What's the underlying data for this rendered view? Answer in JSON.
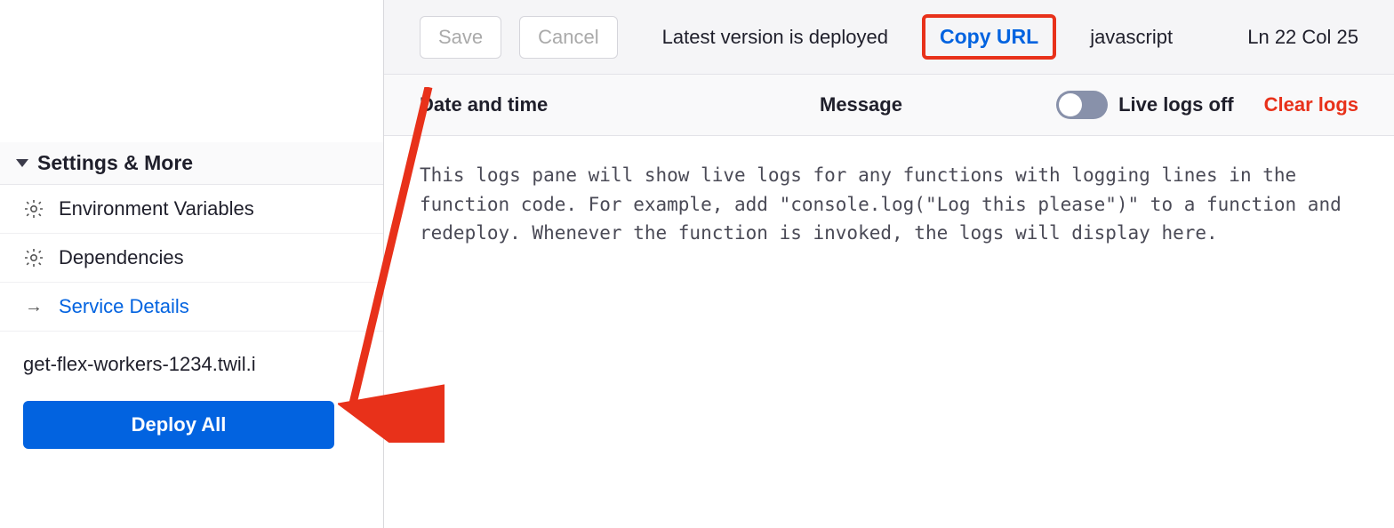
{
  "sidebar": {
    "section_title": "Settings & More",
    "items": [
      {
        "label": "Environment Variables",
        "icon": "gear"
      },
      {
        "label": "Dependencies",
        "icon": "gear"
      },
      {
        "label": "Service Details",
        "icon": "arrow",
        "link": true
      }
    ],
    "domain": "get-flex-workers-1234.twil.i",
    "deploy_label": "Deploy All"
  },
  "toolbar": {
    "save_label": "Save",
    "cancel_label": "Cancel",
    "status": "Latest version is deployed",
    "copy_url_label": "Copy URL",
    "language": "javascript",
    "line": 22,
    "col": 25,
    "ln_col_text": "Ln 22  Col 25"
  },
  "logs": {
    "col_date": "Date and time",
    "col_message": "Message",
    "live_label": "Live logs off",
    "live_on": false,
    "clear_label": "Clear logs",
    "placeholder": "This logs pane will show live logs for any functions with logging lines in the function code. For example, add \"console.log(\"Log this please\")\" to a function and redeploy. Whenever the function is invoked, the logs will display here."
  },
  "annotation": {
    "highlight_target": "copy-url-button",
    "arrow_color": "#e8311a"
  }
}
